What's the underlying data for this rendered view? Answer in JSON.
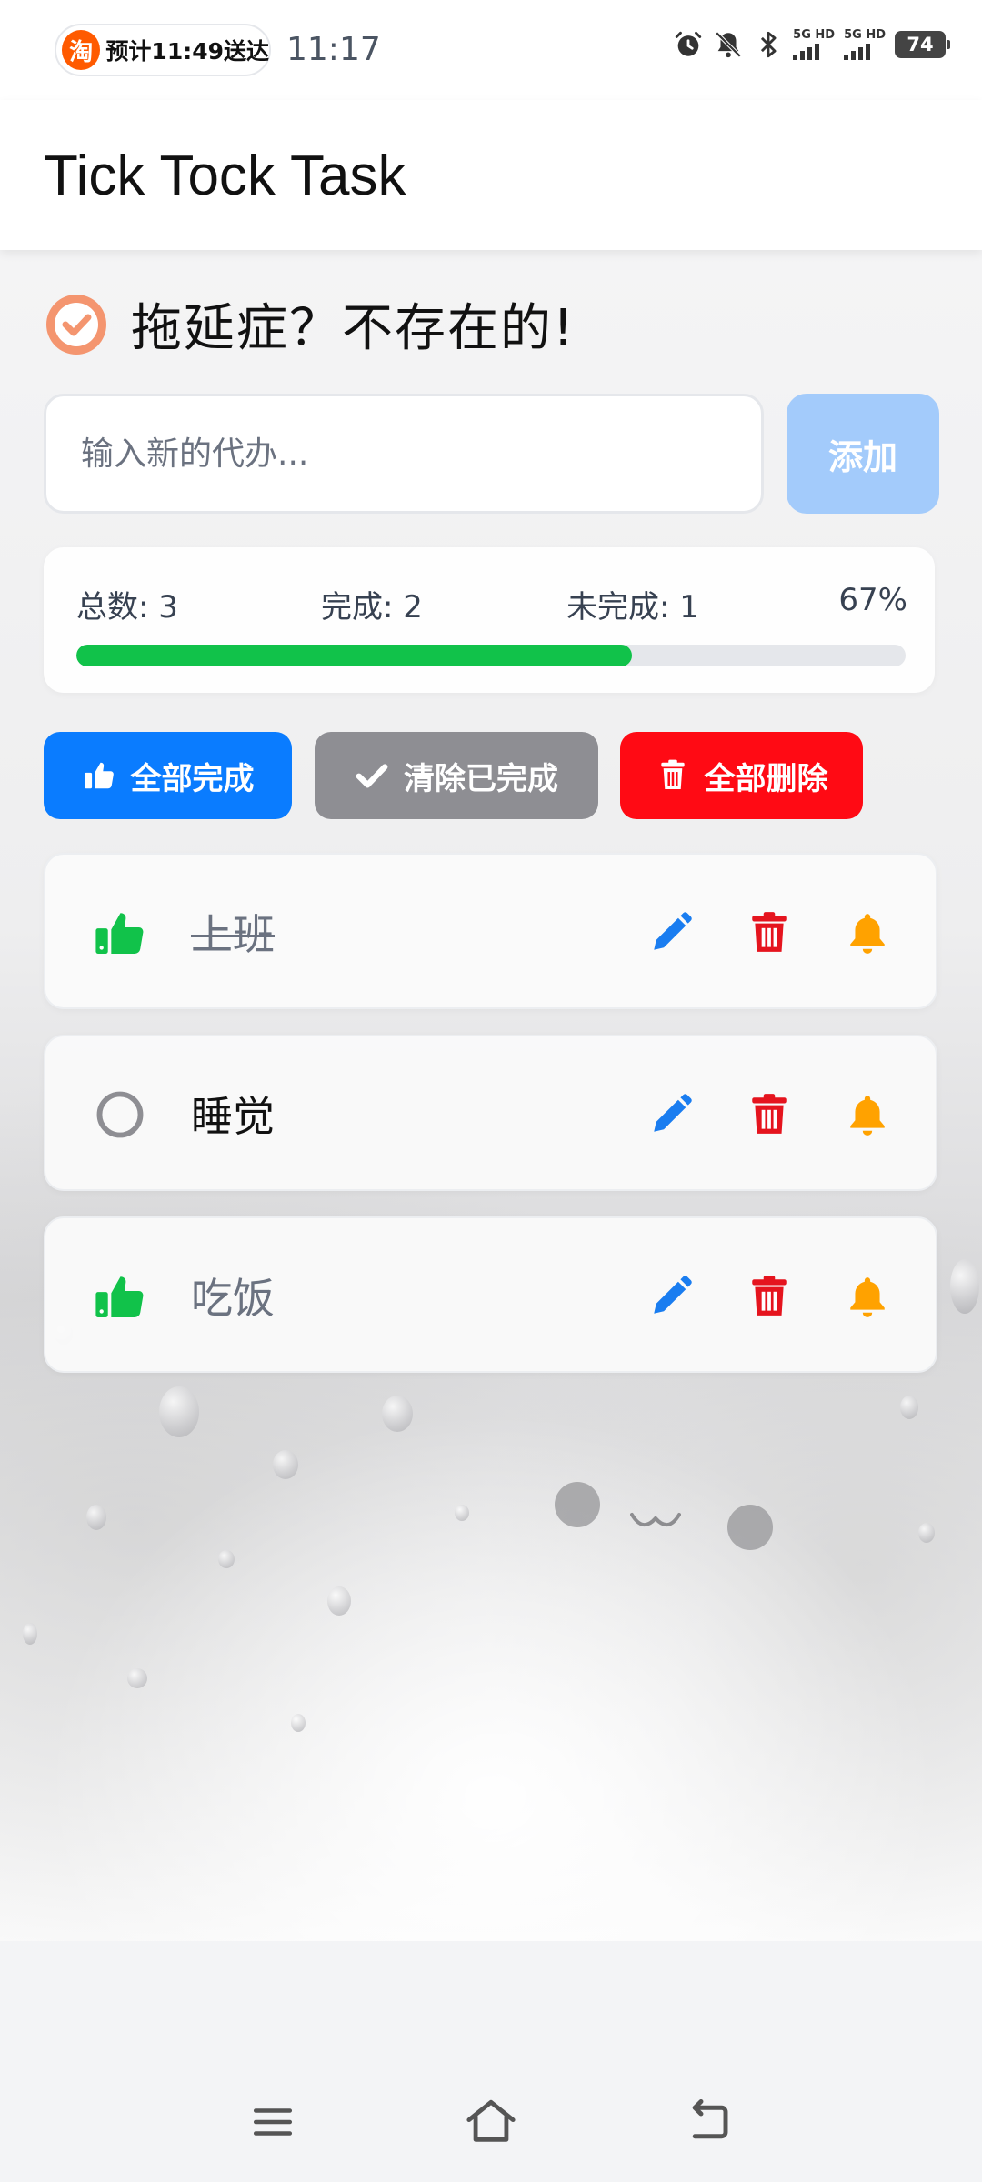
{
  "status_bar": {
    "taobao_badge": "淘",
    "delivery_text": "预计11:49送达",
    "time": "11:17",
    "signal1_label": "5G HD",
    "signal2_label": "5G HD",
    "battery": "74",
    "icons": [
      "alarm-icon",
      "mute-bell-icon",
      "bluetooth-icon"
    ]
  },
  "app": {
    "title": "Tick Tock Task"
  },
  "heading": {
    "text": "拖延症？不存在的!",
    "icon": "check-circle-icon",
    "icon_color": "#f4956f"
  },
  "input": {
    "placeholder": "输入新的代办...",
    "value": "",
    "add_label": "添加",
    "add_color": "#a3cbfb"
  },
  "stats": {
    "total": "总数: 3",
    "done": "完成: 2",
    "undone": "未完成: 1",
    "percent": "67%",
    "progress": 0.67,
    "progress_color": "#11c24a"
  },
  "actions": {
    "complete_all": {
      "label": "全部完成",
      "icon": "thumbs-up-icon",
      "color": "#0a7cff"
    },
    "clear_done": {
      "label": "清除已完成",
      "icon": "checkmark-icon",
      "color": "#8e8e93"
    },
    "delete_all": {
      "label": "全部删除",
      "icon": "trash-icon",
      "color": "#ff0a14"
    }
  },
  "tasks": [
    {
      "label": "上班",
      "done": true,
      "status_icon": "thumbs-up-icon"
    },
    {
      "label": "睡觉",
      "done": false,
      "status_icon": "empty-circle-icon"
    },
    {
      "label": "吃饭",
      "done": true,
      "status_icon": "thumbs-up-icon"
    }
  ],
  "task_actions": {
    "edit": {
      "icon": "pencil-icon",
      "color": "#1a7df0"
    },
    "delete": {
      "icon": "trash-icon",
      "color": "#e5141e"
    },
    "remind": {
      "icon": "bell-icon",
      "color": "#ffa200"
    }
  },
  "nav_bar": {
    "icons": [
      "menu-icon",
      "home-icon",
      "back-icon"
    ]
  }
}
